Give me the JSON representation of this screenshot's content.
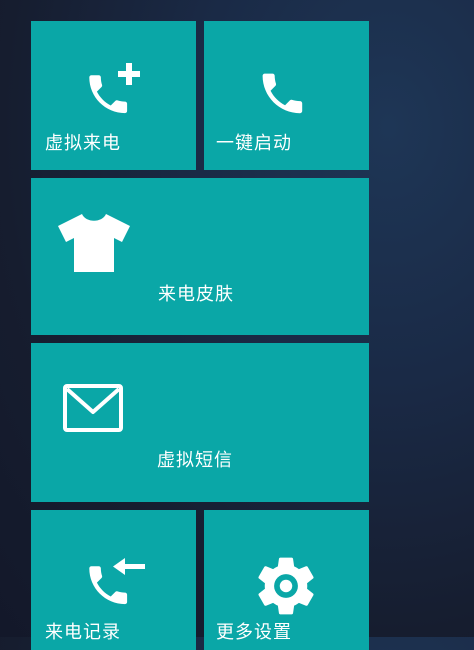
{
  "tiles": {
    "virtual_call": {
      "label": "虚拟来电",
      "icon": "phone-add-icon"
    },
    "quick_start": {
      "label": "一键启动",
      "icon": "phone-icon"
    },
    "call_skin": {
      "label": "来电皮肤",
      "icon": "tshirt-icon"
    },
    "virtual_sms": {
      "label": "虚拟短信",
      "icon": "envelope-icon"
    },
    "call_log": {
      "label": "来电记录",
      "icon": "phone-incoming-icon"
    },
    "more_settings": {
      "label": "更多设置",
      "icon": "gear-icon"
    }
  },
  "colors": {
    "tile": "#0aa7a7",
    "icon": "#ffffff",
    "background": "#161d2f"
  }
}
